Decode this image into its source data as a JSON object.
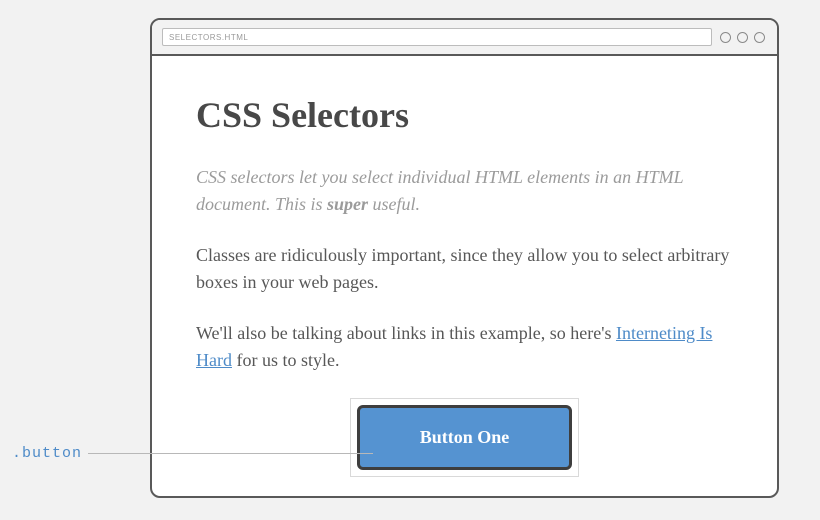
{
  "browser": {
    "url": "SELECTORS.HTML"
  },
  "page": {
    "heading": "CSS Selectors",
    "intro_pre": "CSS selectors let you select individual HTML elements in an HTML document. This is ",
    "intro_strong": "super",
    "intro_post": " useful.",
    "para1": "Classes are ridiculously important, since they allow you to select arbitrary boxes in your web pages.",
    "para2_pre": "We'll also be talking about links in this example, so here's ",
    "link_text": "Interneting Is Hard",
    "para2_post": " for us to style.",
    "button_label": "Button One"
  },
  "annotation": {
    "label": ".button"
  }
}
